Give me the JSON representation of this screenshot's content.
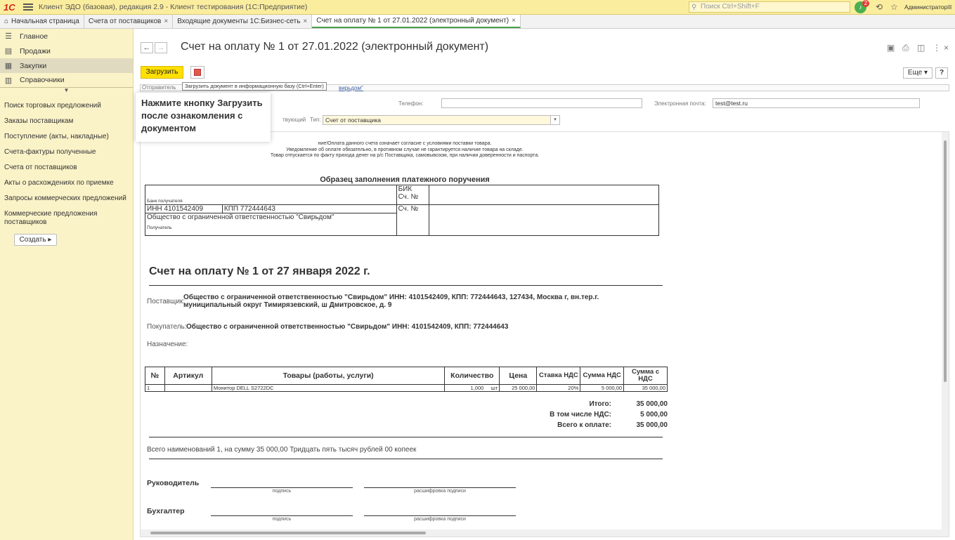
{
  "app": {
    "logo": "1С",
    "title": "Клиент ЭДО (базовая), редакция 2.9 - Клиент тестирования (1С:Предприятие)",
    "search_placeholder": "Поиск Ctrl+Shift+F",
    "notifications_count": "2",
    "user": "Администратор"
  },
  "tabs": [
    {
      "label": "Начальная страница"
    },
    {
      "label": "Счета от поставщиков"
    },
    {
      "label": "Входящие документы 1С:Бизнес-сеть"
    },
    {
      "label": "Счет на оплату № 1 от 27.01.2022 (электронный документ)"
    }
  ],
  "sidebar": {
    "sections": [
      {
        "label": "Главное",
        "icon": "menu-icon"
      },
      {
        "label": "Продажи",
        "icon": "sales-icon"
      },
      {
        "label": "Закупки",
        "icon": "purchases-icon"
      },
      {
        "label": "Справочники",
        "icon": "references-icon"
      }
    ],
    "links": [
      "Поиск торговых предложений",
      "Заказы поставщикам",
      "Поступление (акты, накладные)",
      "Счета-фактуры полученные",
      "Счета от поставщиков",
      "Акты о расхождениях по приемке",
      "Запросы коммерческих предложений",
      "Коммерческие предложения поставщиков"
    ],
    "create_label": "Создать"
  },
  "main": {
    "title": "Счет на оплату № 1 от 27.01.2022 (электронный документ)",
    "load_button": "Загрузить",
    "more_button": "Еще",
    "help_button": "?",
    "tooltip": "Загрузить документ в информационную базу (Ctrl+Enter)",
    "sender_label": "Отправитель",
    "sender_link": "вирьдом\"",
    "hint": "Нажмите кнопку Загрузить после ознакомления с документом",
    "phone_label": "Телефон:",
    "phone_value": "",
    "email_label": "Электронная почта:",
    "email_value": "test@test.ru",
    "status_text": "твующий",
    "type_label": "Тип:",
    "type_value": "Счет от поставщика"
  },
  "document": {
    "notice_lines": [
      "ние!Оплата данного счета означает согласие с условиями поставки товара.",
      "Уведомление об оплате обязательно, в противном случае не гарантируется наличие товара на складе.",
      "Товар отпускается по факту прихода денег на р/с Поставщика, самовывозом, при наличии доверенности и паспорта."
    ],
    "payment_title": "Образец заполнения платежного поручения",
    "bik_label": "БИК",
    "account_label": "Сч. №",
    "bank_label": "Банк получателя",
    "inn": "ИНН 4101542409",
    "kpp": "КПП 772444643",
    "recipient_name": "Общество с ограниченной ответственностью \"Свирьдом\"",
    "recipient_label": "Получатель",
    "invoice_title": "Счет на оплату № 1 от 27 января 2022 г.",
    "supplier_label": "Поставщик:",
    "supplier_value": "Общество с ограниченной ответственностью \"Свирьдом\" ИНН: 4101542409, КПП: 772444643, 127434, Москва г, вн.тер.г. муниципальный округ Тимирязевский, ш Дмитровское, д. 9",
    "buyer_label": "Покупатель:",
    "buyer_value": "Общество с ограниченной ответственностью \"Свирьдом\" ИНН: 4101542409, КПП: 772444643",
    "purpose_label": "Назначение:",
    "columns": [
      "№",
      "Артикул",
      "Товары (работы, услуги)",
      "Количество",
      "Цена",
      "Ставка НДС",
      "Сумма НДС",
      "Сумма с НДС"
    ],
    "rows": [
      {
        "n": "1",
        "article": "",
        "name": "Монитор DELL S2722DC",
        "qty": "1,000",
        "unit": "шт",
        "price": "25 000,00",
        "vat_rate": "20%",
        "vat_sum": "5 000,00",
        "total": "35 000,00"
      }
    ],
    "total_label": "Итого:",
    "total_value": "35 000,00",
    "vat_label": "В том числе НДС:",
    "vat_value": "5 000,00",
    "pay_label": "Всего к оплате:",
    "pay_value": "35 000,00",
    "sum_text": "Всего наименований 1, на сумму 35 000,00 Тридцать пять тысяч рублей 00 копеек",
    "head_label": "Руководитель",
    "accountant_label": "Бухгалтер",
    "sign_caption": "подпись",
    "decode_caption": "расшифровка подписи"
  }
}
